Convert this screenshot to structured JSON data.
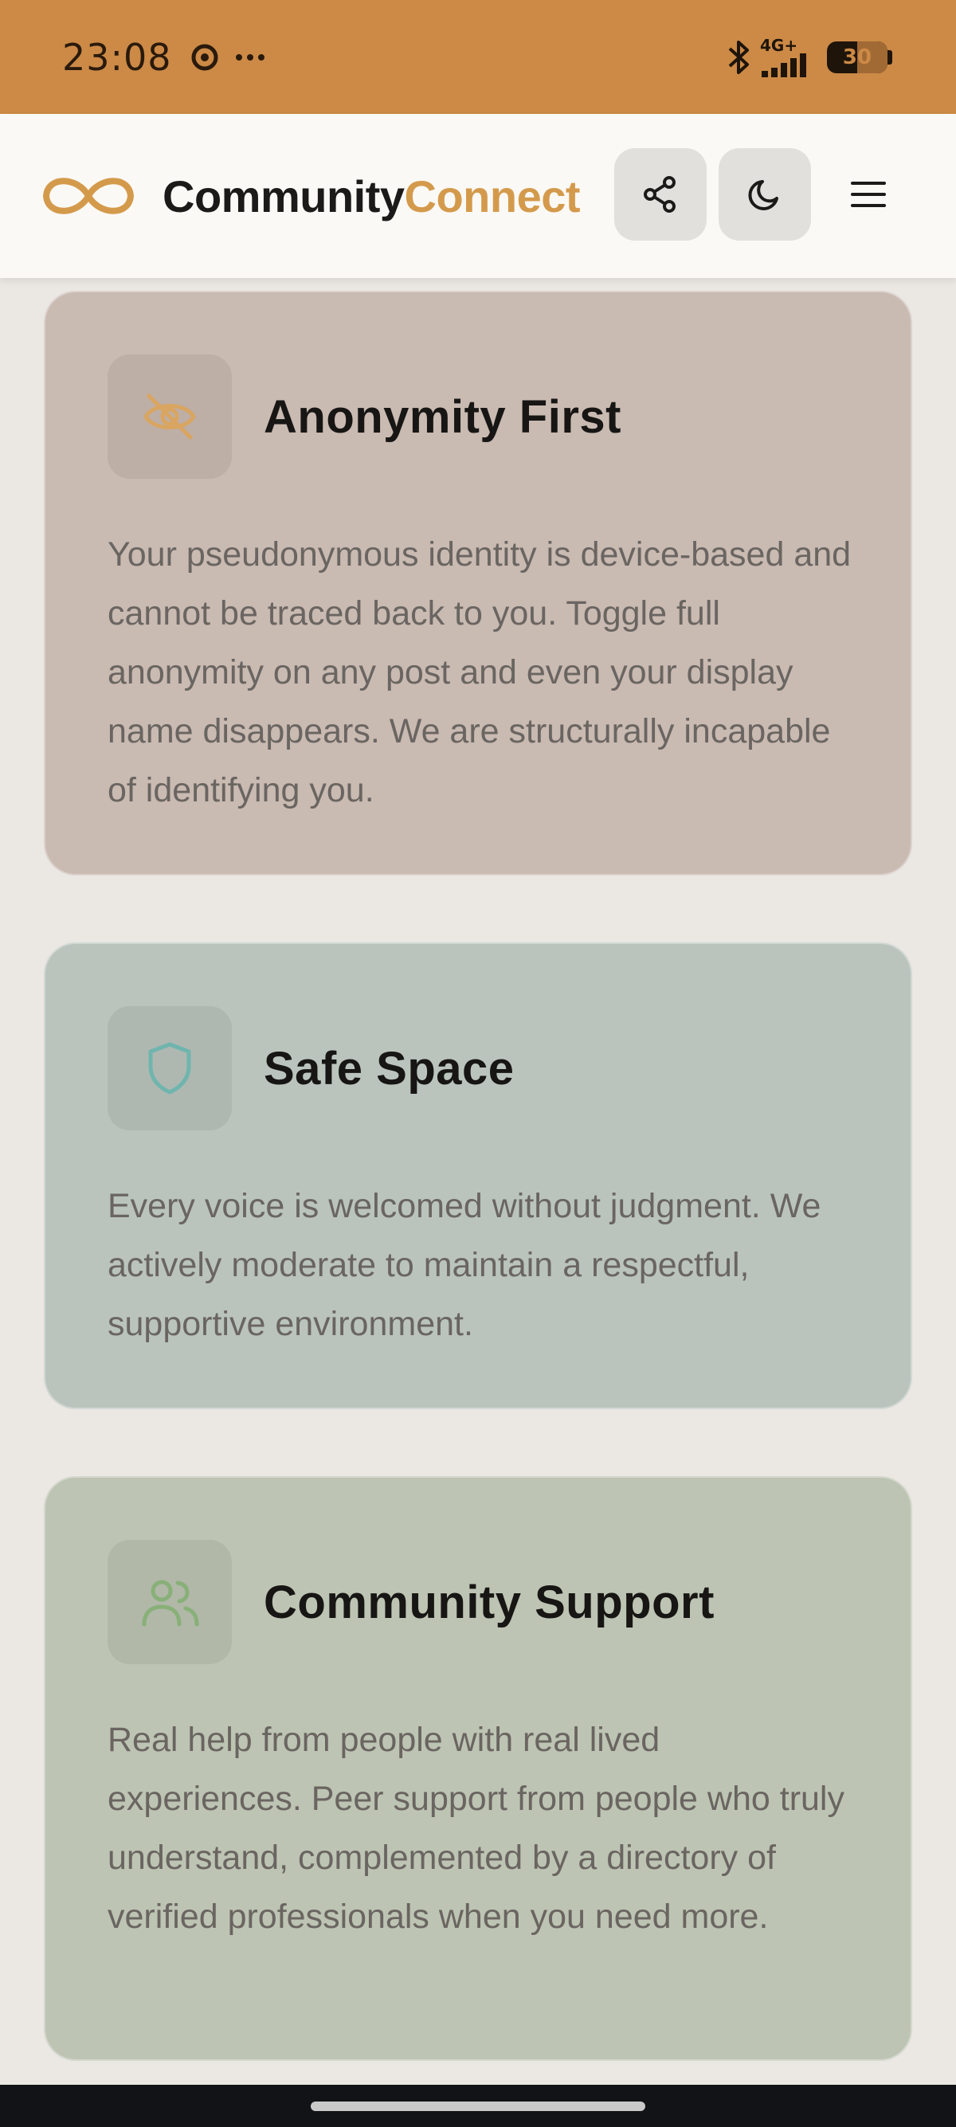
{
  "status_bar": {
    "time": "23:08",
    "network": "4G+",
    "battery": "30"
  },
  "header": {
    "brand_part1": "Community",
    "brand_part2": "Connect",
    "colors": {
      "accent": "#d49a4c",
      "status_bar": "#cc8a46"
    }
  },
  "cards": [
    {
      "icon": "eye-off-icon",
      "title": "Anonymity First",
      "body": "Your pseudonymous identity is device-based and cannot be traced back to you. Toggle full anonymity on any post and even your display name disappears. We are structurally incapable of identifying you.",
      "icon_color": "#d9a560"
    },
    {
      "icon": "shield-icon",
      "title": "Safe Space",
      "body": "Every voice is welcomed without judgment. We actively moderate to maintain a respectful, supportive environment.",
      "icon_color": "#6fb5ae"
    },
    {
      "icon": "users-icon",
      "title": "Community Support",
      "body": "Real help from people with real lived experiences. Peer support from people who truly understand, complemented by a directory of verified professionals when you need more.",
      "icon_color": "#88b078"
    }
  ]
}
